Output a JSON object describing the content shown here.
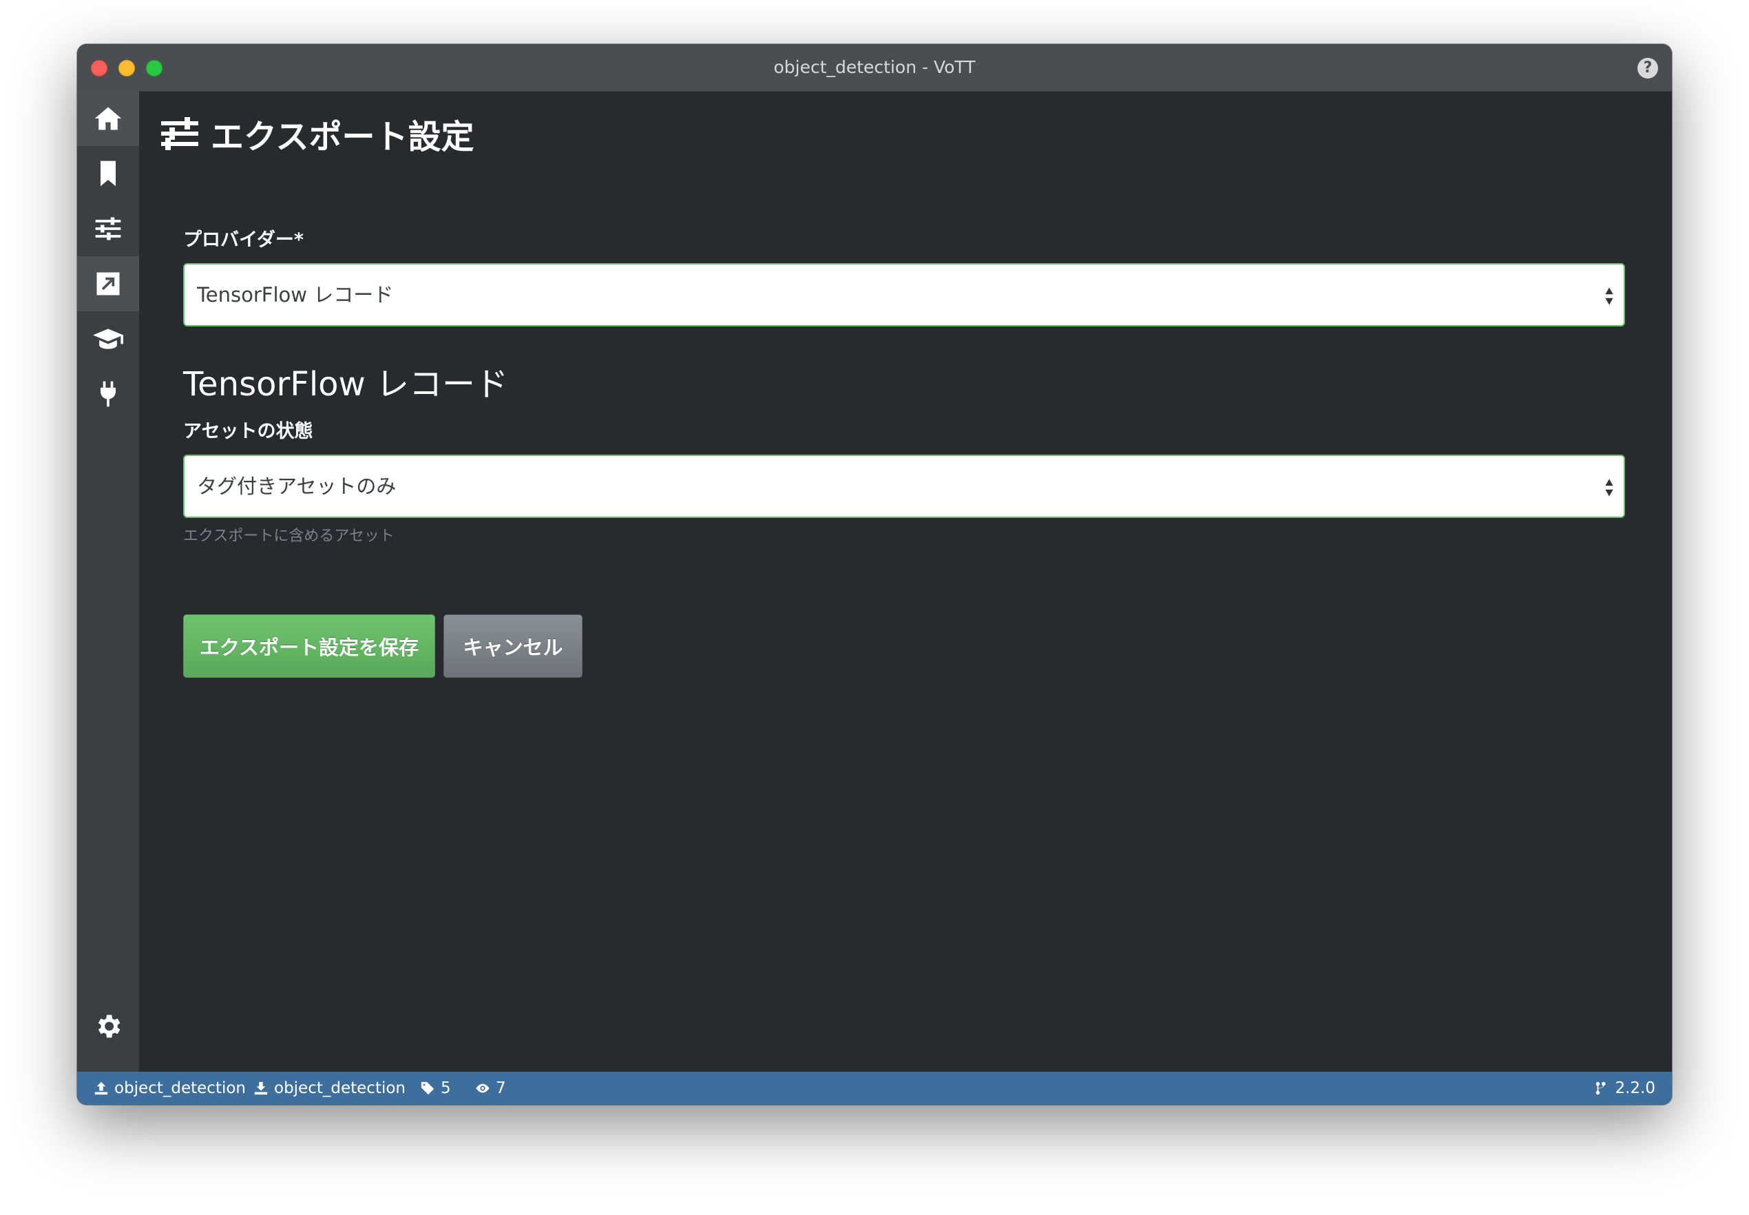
{
  "window": {
    "title": "object_detection - VoTT"
  },
  "sidebar": {
    "items": [
      {
        "icon": "home-icon"
      },
      {
        "icon": "bookmark-icon"
      },
      {
        "icon": "sliders-icon"
      },
      {
        "icon": "export-icon",
        "active": true
      },
      {
        "icon": "graduation-cap-icon"
      },
      {
        "icon": "plug-icon"
      }
    ],
    "settings_icon": "gear-icon"
  },
  "page": {
    "title": "エクスポート設定",
    "provider_label": "プロバイダー*",
    "provider_value": "TensorFlow レコード",
    "section_title": "TensorFlow レコード",
    "asset_state_label": "アセットの状態",
    "asset_state_value": "タグ付きアセットのみ",
    "asset_state_help": "エクスポートに含めるアセット",
    "save_button": "エクスポート設定を保存",
    "cancel_button": "キャンセル"
  },
  "statusbar": {
    "source": "object_detection",
    "target": "object_detection",
    "tag_count": "5",
    "visited_count": "7",
    "version": "2.2.0"
  },
  "colors": {
    "accent_green": "#62c462",
    "statusbar": "#3e6e9c",
    "background": "#272b30"
  }
}
